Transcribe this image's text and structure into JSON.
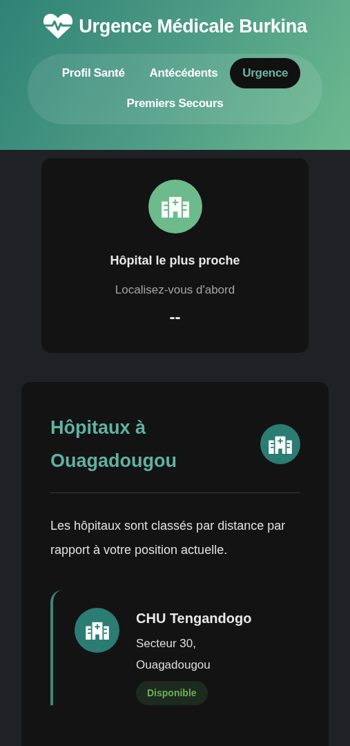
{
  "app": {
    "title": "Urgence Médicale Burkina"
  },
  "tabs": [
    {
      "label": "Profil Santé",
      "selected": false
    },
    {
      "label": "Antécédents",
      "selected": false
    },
    {
      "label": "Urgence",
      "selected": true
    },
    {
      "label": "Premiers Secours",
      "selected": false
    }
  ],
  "nearest": {
    "title": "Hôpital le plus proche",
    "subtitle": "Localisez-vous d'abord",
    "distance": "--"
  },
  "hospitals_panel": {
    "title": "Hôpitaux à Ouagadougou",
    "description": "Les hôpitaux sont classés par distance par rapport à votre position actuelle.",
    "hospitals": [
      {
        "name": "CHU Tengandogo",
        "address": "Secteur 30, Ouagadougou",
        "status": {
          "label": "Disponible",
          "kind": "available"
        }
      }
    ]
  }
}
